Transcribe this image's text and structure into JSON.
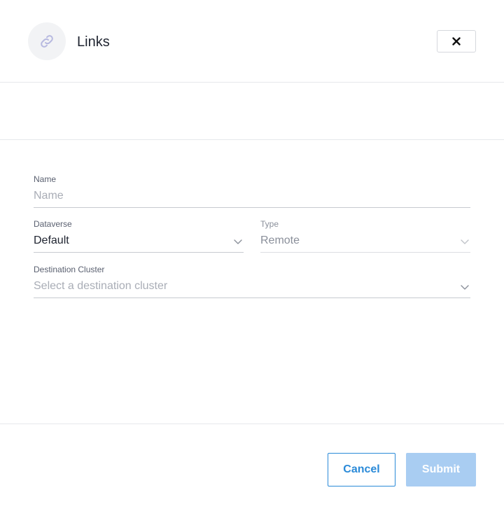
{
  "header": {
    "title": "Links",
    "icon": "link-icon",
    "close_icon": "close-icon"
  },
  "form": {
    "name": {
      "label": "Name",
      "placeholder": "Name",
      "value": ""
    },
    "dataverse": {
      "label": "Dataverse",
      "value": "Default"
    },
    "type": {
      "label": "Type",
      "value": "Remote",
      "disabled": true
    },
    "destination_cluster": {
      "label": "Destination Cluster",
      "placeholder": "Select a destination cluster"
    }
  },
  "footer": {
    "cancel_label": "Cancel",
    "submit_label": "Submit"
  },
  "colors": {
    "accent": "#2a8ad8",
    "submit_disabled": "#a9cdf2",
    "divider": "#e6e8ec"
  }
}
